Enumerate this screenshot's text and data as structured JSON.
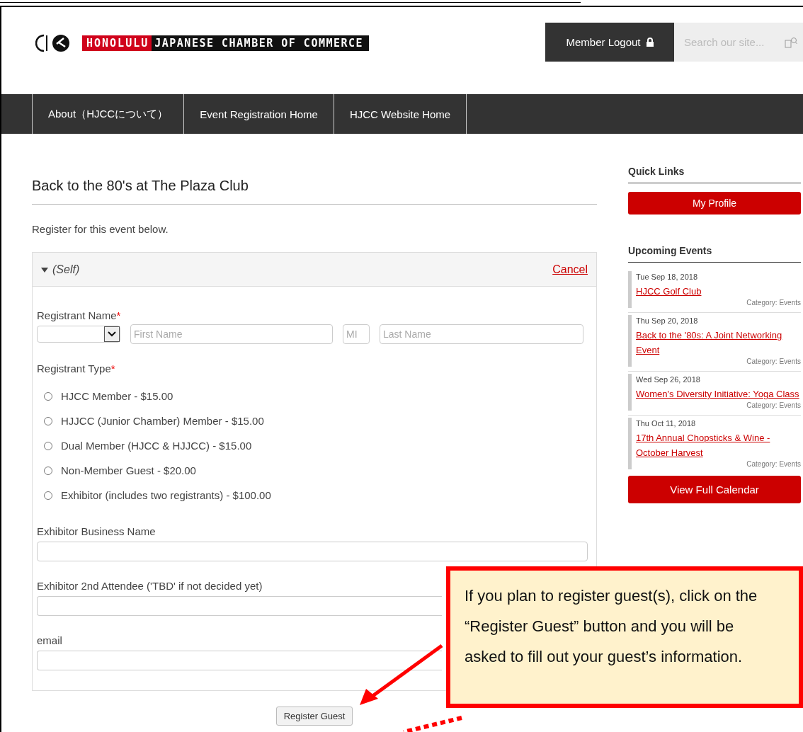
{
  "header": {
    "logo_red": "HONOLULU",
    "logo_black": "JAPANESE CHAMBER OF COMMERCE",
    "logout_button": "Member Logout",
    "search": {
      "placeholder": "Search our site..."
    }
  },
  "nav": [
    {
      "label": "About（HJCCについて）"
    },
    {
      "label": "Event Registration Home"
    },
    {
      "label": "HJCC Website Home"
    }
  ],
  "page_title": "Back to the 80's at The Plaza Club",
  "intro": "Register for this event below.",
  "panel": {
    "title": "(Self)",
    "expanded": true,
    "cancel": "Cancel",
    "required_mark": "*",
    "name_label": "Registrant Name",
    "name_required": true,
    "name_fields": [
      {
        "kind": "select"
      },
      {
        "kind": "text",
        "placeholder": "First Name"
      },
      {
        "kind": "text",
        "placeholder": "MI"
      },
      {
        "kind": "text",
        "placeholder": "Last Name"
      }
    ],
    "type_label": "Registrant Type",
    "type_required": true,
    "types": [
      {
        "label": "HJCC Member - $15.00",
        "selected": false
      },
      {
        "label": "HJJCC (Junior Chamber) Member - $15.00",
        "selected": false
      },
      {
        "label": "Dual Member (HJCC & HJJCC) - $15.00",
        "selected": false
      },
      {
        "label": "Non-Member Guest - $20.00",
        "selected": false
      },
      {
        "label": "Exhibitor (includes two registrants) - $100.00",
        "selected": false
      }
    ],
    "fields": [
      {
        "label": "Exhibitor Business Name"
      },
      {
        "label": "Exhibitor 2nd Attendee ('TBD' if not decided yet)"
      },
      {
        "label": "email"
      }
    ]
  },
  "register_guest_button": "Register Guest",
  "sidebar": {
    "quick_links_title": "Quick Links",
    "profile_button": "My Profile",
    "upcoming_title": "Upcoming Events",
    "events": [
      {
        "date": "Tue Sep 18, 2018",
        "title": "HJCC Golf Club",
        "category": "Category: Events"
      },
      {
        "date": "Thu Sep 20, 2018",
        "title": "Back to the '80s: A Joint Networking Event",
        "category": "Category: Events"
      },
      {
        "date": "Wed Sep 26, 2018",
        "title": "Women's Diversity Initiative: Yoga Class",
        "category": "Category: Events"
      },
      {
        "date": "Thu Oct 11, 2018",
        "title": "17th Annual Chopsticks & Wine - October Harvest",
        "category": "Category: Events"
      }
    ],
    "calendar_button": "View Full Calendar"
  },
  "callout": {
    "text": "If you plan to register guest(s), click on the “Register Guest” button and you will be asked to fill out your guest’s information."
  }
}
